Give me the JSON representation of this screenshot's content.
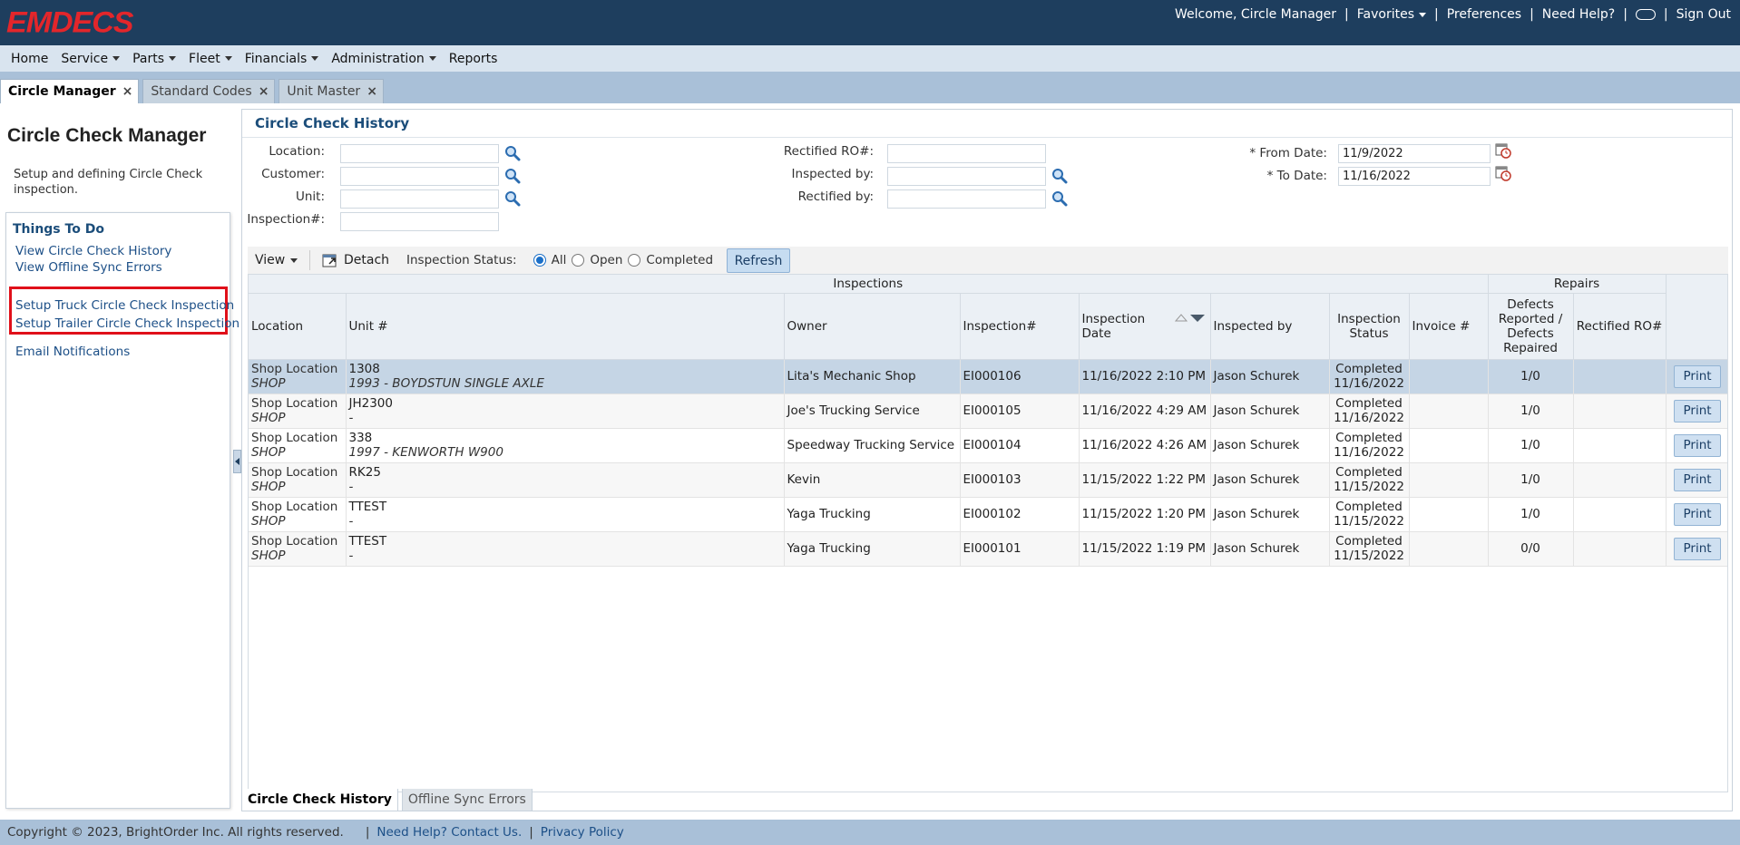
{
  "app": {
    "logo": "EMDECS"
  },
  "topnav": {
    "welcome": "Welcome, Circle Manager",
    "favorites": "Favorites",
    "preferences": "Preferences",
    "help": "Need Help?",
    "signout": "Sign Out",
    "sep": "|"
  },
  "menu": {
    "home": "Home",
    "service": "Service",
    "parts": "Parts",
    "fleet": "Fleet",
    "financials": "Financials",
    "administration": "Administration",
    "reports": "Reports"
  },
  "tabs": {
    "t1": "Circle Manager",
    "t2": "Standard Codes",
    "t3": "Unit Master",
    "close": "×"
  },
  "left": {
    "title": "Circle Check Manager",
    "desc": "Setup and defining Circle Check inspection.",
    "todo_title": "Things To Do",
    "link1": "View Circle Check History",
    "link2": "View Offline Sync Errors",
    "link3": "Setup Truck Circle Check Inspection",
    "link4": "Setup Trailer Circle Check Inspection",
    "link5": "Email Notifications"
  },
  "filters": {
    "title": "Circle Check History",
    "location_label": "Location:",
    "location_value": "",
    "customer_label": "Customer:",
    "customer_value": "",
    "unit_label": "Unit:",
    "unit_value": "",
    "inspection_label": "Inspection#:",
    "inspection_value": "",
    "rectified_ro_label": "Rectified RO#:",
    "rectified_ro_value": "",
    "inspected_by_label": "Inspected by:",
    "inspected_by_value": "",
    "rectified_by_label": "Rectified by:",
    "rectified_by_value": "",
    "from_label": "* From Date:",
    "from_value": "11/9/2022",
    "to_label": "* To Date:",
    "to_value": "11/16/2022"
  },
  "toolbar": {
    "view": "View",
    "detach": "Detach",
    "status_label": "Inspection Status:",
    "opt_all": "All",
    "opt_open": "Open",
    "opt_completed": "Completed",
    "selected": "All",
    "refresh": "Refresh"
  },
  "grid": {
    "group_inspections": "Inspections",
    "group_repairs": "Repairs",
    "col_location": "Location",
    "col_unit": "Unit #",
    "col_owner": "Owner",
    "col_inspection": "Inspection#",
    "col_date_1": "Inspection",
    "col_date_2": "Date",
    "col_by": "Inspected by",
    "col_status_1": "Inspection",
    "col_status_2": "Status",
    "col_invoice": "Invoice #",
    "col_defects_1": "Defects",
    "col_defects_2": "Reported /",
    "col_defects_3": "Defects",
    "col_defects_4": "Repaired",
    "col_rectified": "Rectified RO#",
    "print": "Print",
    "rows": [
      {
        "loc": "Shop Location",
        "loc_sub": "SHOP",
        "unit": "1308",
        "unit_sub": "1993 - BOYDSTUN SINGLE AXLE",
        "owner": "Lita's Mechanic Shop",
        "insp": "EI000106",
        "date": "11/16/2022 2:10 PM",
        "by": "Jason Schurek",
        "status": "Completed",
        "status_date": "11/16/2022",
        "invoice": "",
        "defects": "1/0",
        "rectified": ""
      },
      {
        "loc": "Shop Location",
        "loc_sub": "SHOP",
        "unit": "JH2300",
        "unit_sub": "-",
        "owner": "Joe's Trucking Service",
        "insp": "EI000105",
        "date": "11/16/2022 4:29 AM",
        "by": "Jason Schurek",
        "status": "Completed",
        "status_date": "11/16/2022",
        "invoice": "",
        "defects": "1/0",
        "rectified": ""
      },
      {
        "loc": "Shop Location",
        "loc_sub": "SHOP",
        "unit": "338",
        "unit_sub": "1997 - KENWORTH W900",
        "owner": "Speedway Trucking Service",
        "insp": "EI000104",
        "date": "11/16/2022 4:26 AM",
        "by": "Jason Schurek",
        "status": "Completed",
        "status_date": "11/16/2022",
        "invoice": "",
        "defects": "1/0",
        "rectified": ""
      },
      {
        "loc": "Shop Location",
        "loc_sub": "SHOP",
        "unit": "RK25",
        "unit_sub": "-",
        "owner": "Kevin",
        "insp": "EI000103",
        "date": "11/15/2022 1:22 PM",
        "by": "Jason Schurek",
        "status": "Completed",
        "status_date": "11/15/2022",
        "invoice": "",
        "defects": "1/0",
        "rectified": ""
      },
      {
        "loc": "Shop Location",
        "loc_sub": "SHOP",
        "unit": "TTEST",
        "unit_sub": "-",
        "owner": "Yaga Trucking",
        "insp": "EI000102",
        "date": "11/15/2022 1:20 PM",
        "by": "Jason Schurek",
        "status": "Completed",
        "status_date": "11/15/2022",
        "invoice": "",
        "defects": "1/0",
        "rectified": ""
      },
      {
        "loc": "Shop Location",
        "loc_sub": "SHOP",
        "unit": "TTEST",
        "unit_sub": "-",
        "owner": "Yaga Trucking",
        "insp": "EI000101",
        "date": "11/15/2022 1:19 PM",
        "by": "Jason Schurek",
        "status": "Completed",
        "status_date": "11/15/2022",
        "invoice": "",
        "defects": "0/0",
        "rectified": ""
      }
    ]
  },
  "bottom_tabs": {
    "t1": "Circle Check History",
    "t2": "Offline Sync Errors"
  },
  "footer": {
    "copyright": "Copyright © 2023, BrightOrder Inc. All rights reserved.",
    "sep": "|",
    "help": "Need Help? Contact Us.",
    "privacy": "Privacy Policy"
  },
  "colors": {
    "topbar": "#1e3e5e",
    "logo": "#e3262b",
    "accent": "#1b4d7a",
    "highlight": "#e0101a"
  }
}
